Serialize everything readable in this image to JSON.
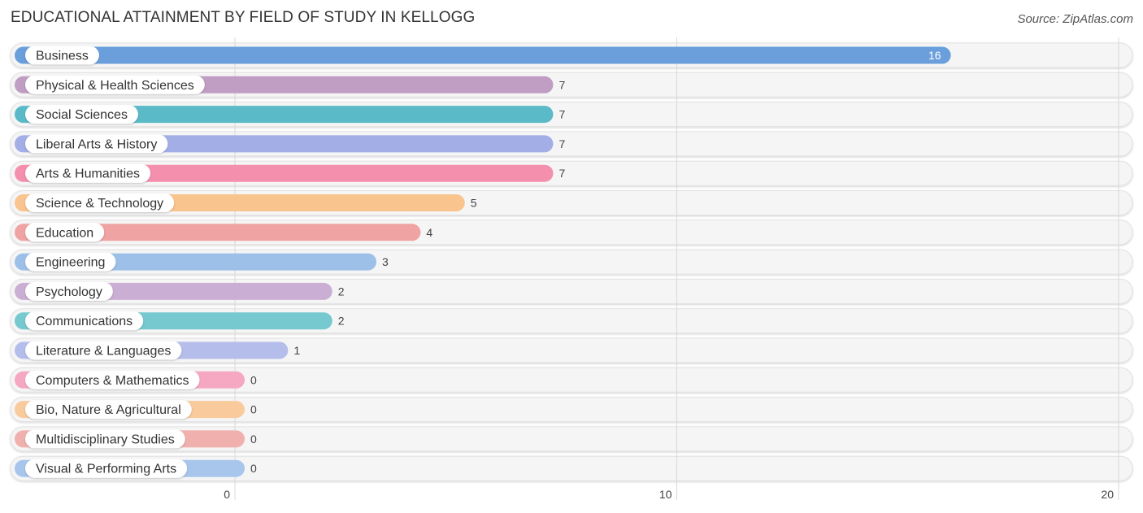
{
  "header": {
    "title": "EDUCATIONAL ATTAINMENT BY FIELD OF STUDY IN KELLOGG",
    "source": "Source: ZipAtlas.com"
  },
  "chart_data": {
    "type": "bar",
    "orientation": "horizontal",
    "title": "EDUCATIONAL ATTAINMENT BY FIELD OF STUDY IN KELLOGG",
    "xlabel": "",
    "ylabel": "",
    "xlim": [
      0,
      20
    ],
    "xticks": [
      0,
      10,
      20
    ],
    "xtick_labels": [
      "0",
      "10",
      "20"
    ],
    "grid": true,
    "categories": [
      "Business",
      "Physical & Health Sciences",
      "Social Sciences",
      "Liberal Arts & History",
      "Arts & Humanities",
      "Science & Technology",
      "Education",
      "Engineering",
      "Psychology",
      "Communications",
      "Literature & Languages",
      "Computers & Mathematics",
      "Bio, Nature & Agricultural",
      "Multidisciplinary Studies",
      "Visual & Performing Arts"
    ],
    "values": [
      16,
      7,
      7,
      7,
      7,
      5,
      4,
      3,
      2,
      2,
      1,
      0,
      0,
      0,
      0
    ],
    "value_labels": [
      "16",
      "7",
      "7",
      "7",
      "7",
      "5",
      "4",
      "3",
      "2",
      "2",
      "1",
      "0",
      "0",
      "0",
      "0"
    ],
    "colors": [
      "#6a9fdb",
      "#c09ec4",
      "#5bbac8",
      "#a3aee6",
      "#f48fae",
      "#f9c48e",
      "#f0a3a3",
      "#9dc0e8",
      "#cbaed3",
      "#76c9cf",
      "#b5bdeb",
      "#f6a8c2",
      "#f9cb9c",
      "#f0b0ae",
      "#a8c6ec"
    ]
  }
}
